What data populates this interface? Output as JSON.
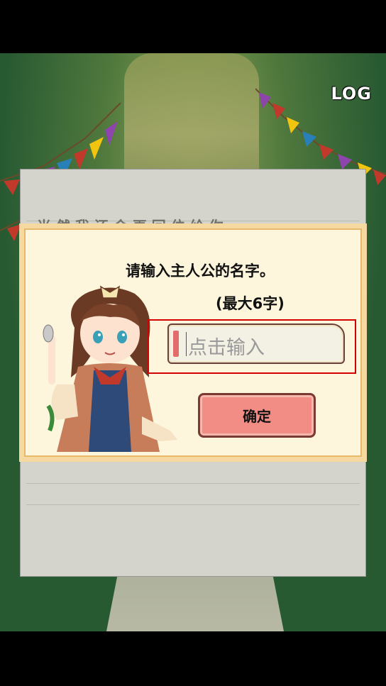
{
  "header": {
    "log_label": "LOG"
  },
  "background": {
    "partial_text": "当 然 我 还 会 再 回 位 给 你"
  },
  "dialog": {
    "title": "请输入主人公的名字。",
    "subtitle": "(最大6字)",
    "input": {
      "placeholder": "点击输入",
      "value": ""
    },
    "confirm_label": "确定"
  },
  "colors": {
    "confirm_bg": "#f28d86",
    "dialog_bg": "#fdf6dc",
    "dialog_border": "#f6d9a0",
    "highlight": "#d40000"
  },
  "icons": {
    "character": "girl-character-portrait"
  }
}
